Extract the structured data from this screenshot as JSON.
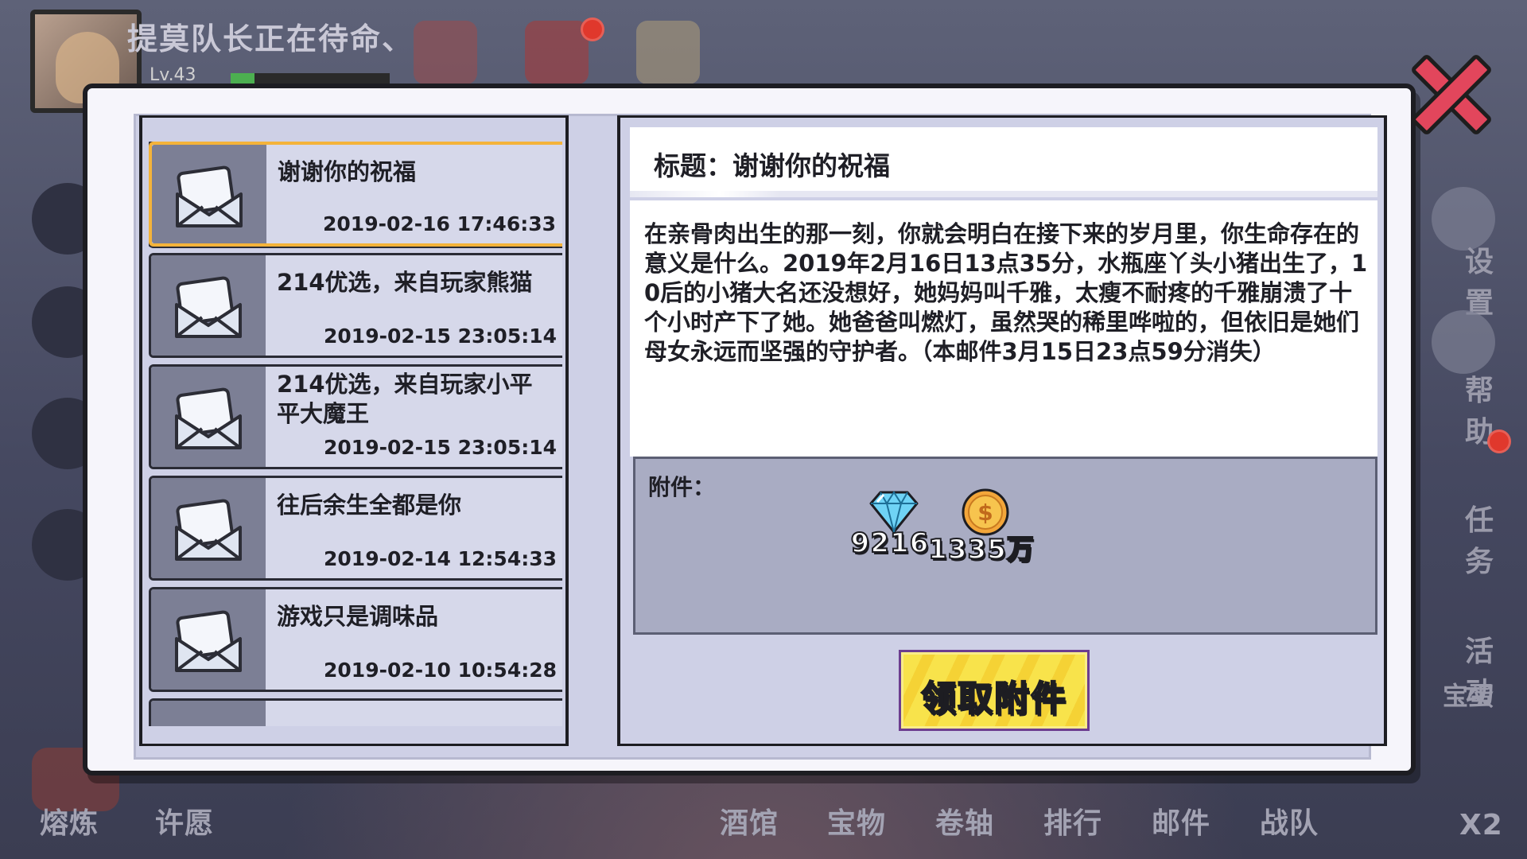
{
  "background": {
    "player_name": "提莫队长正在待命、",
    "player_level": "Lv.43",
    "side_menu": [
      "设置",
      "帮助",
      "任务",
      "活动",
      "宝蛋"
    ],
    "bottom_menu_left": [
      "熔炼",
      "许愿"
    ],
    "bottom_menu_right": [
      "酒馆",
      "宝物",
      "卷轴",
      "排行",
      "邮件",
      "战队"
    ],
    "speed_label": "X2"
  },
  "mail_list": [
    {
      "title": "谢谢你的祝福",
      "time": "2019-02-16 17:46:33"
    },
    {
      "title": "214优选，来自玩家熊猫",
      "time": "2019-02-15 23:05:14"
    },
    {
      "title": "214优选，来自玩家小平平大魔王",
      "time": "2019-02-15 23:05:14"
    },
    {
      "title": "往后余生全都是你",
      "time": "2019-02-14 12:54:33"
    },
    {
      "title": "游戏只是调味品",
      "time": "2019-02-10 10:54:28"
    }
  ],
  "detail": {
    "subject": "标题：谢谢你的祝福",
    "body": "在亲骨肉出生的那一刻，你就会明白在接下来的岁月里，你生命存在的意义是什么。2019年2月16日13点35分，水瓶座丫头小猪出生了，10后的小猪大名还没想好，她妈妈叫千雅，太瘦不耐疼的千雅崩溃了十个小时产下了她。她爸爸叫燃灯，虽然哭的稀里哗啦的，但依旧是她们母女永远而坚强的守护者。（本邮件3月15日23点59分消失）",
    "attachment_label": "附件：",
    "attachments": [
      {
        "icon": "diamond-icon",
        "amount": "9216"
      },
      {
        "icon": "gold-coin-icon",
        "amount": "1335万"
      }
    ],
    "claim_button": "领取附件"
  },
  "colors": {
    "selected_border": "#f4b33a",
    "claim_button": "#f8e34b",
    "close_button": "#e2465c",
    "panel_bg": "#ced0e6"
  }
}
